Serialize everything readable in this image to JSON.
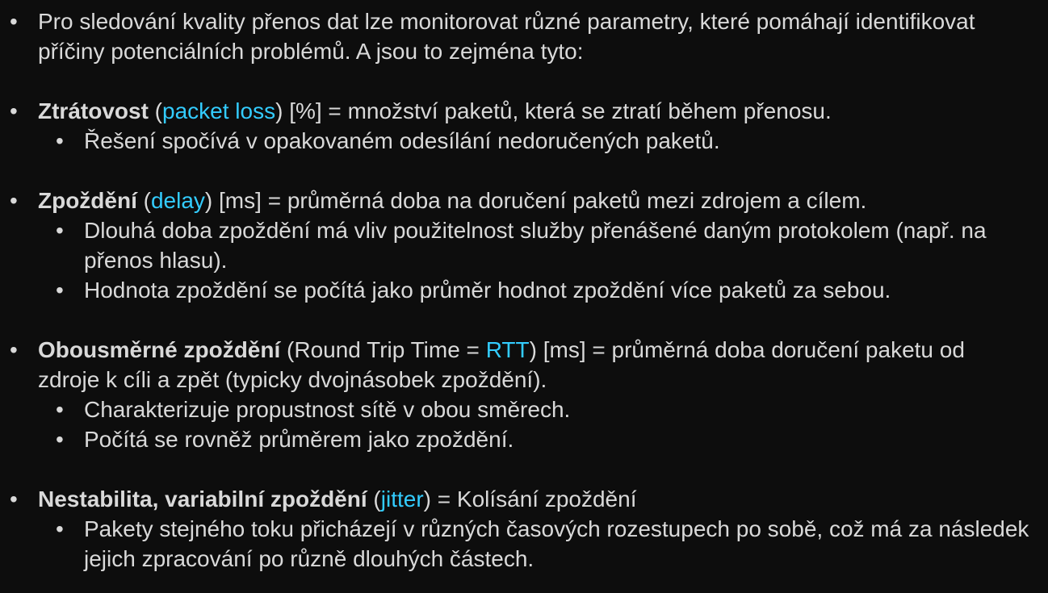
{
  "intro": {
    "text": "Pro sledování kvality přenos dat lze monitorovat různé parametry, které pomáhají identifikovat příčiny potenciálních problémů. A jsou to zejména tyto:"
  },
  "loss": {
    "term": "Ztrátovost",
    "open": " (",
    "keyword": "packet loss",
    "rest": ") [%] = množství paketů, která se ztratí během přenosu.",
    "subs": [
      "Řešení spočívá v opakovaném odesílání nedoručených paketů."
    ]
  },
  "delay": {
    "term": "Zpoždění",
    "open": " (",
    "keyword": "delay",
    "rest": ") [ms] = průměrná doba na doručení paketů mezi zdrojem a cílem.",
    "subs": [
      "Dlouhá doba zpoždění má vliv použitelnost služby přenášené daným protokolem (např. na přenos hlasu).",
      "Hodnota zpoždění se počítá jako průměr hodnot zpoždění více paketů za sebou."
    ]
  },
  "rtt": {
    "term": "Obousměrné zpoždění",
    "open": " (Round Trip Time = ",
    "keyword": "RTT",
    "rest": ") [ms] = průměrná doba doručení paketu od zdroje k cíli a zpět (typicky dvojnásobek zpoždění).",
    "subs": [
      "Charakterizuje propustnost sítě v obou směrech.",
      "Počítá se rovněž průměrem jako zpoždění."
    ]
  },
  "jitter": {
    "term": "Nestabilita, variabilní zpoždění",
    "open": " (",
    "keyword": "jitter",
    "rest": ") = Kolísání zpoždění",
    "subs": [
      "Pakety stejného toku přicházejí v různých časových rozestupech po sobě, což má za následek jejich zpracování po různě dlouhých částech."
    ]
  },
  "colors": {
    "background": "#0d0d0d",
    "text": "#d9d9d9",
    "highlight": "#33ccff"
  }
}
